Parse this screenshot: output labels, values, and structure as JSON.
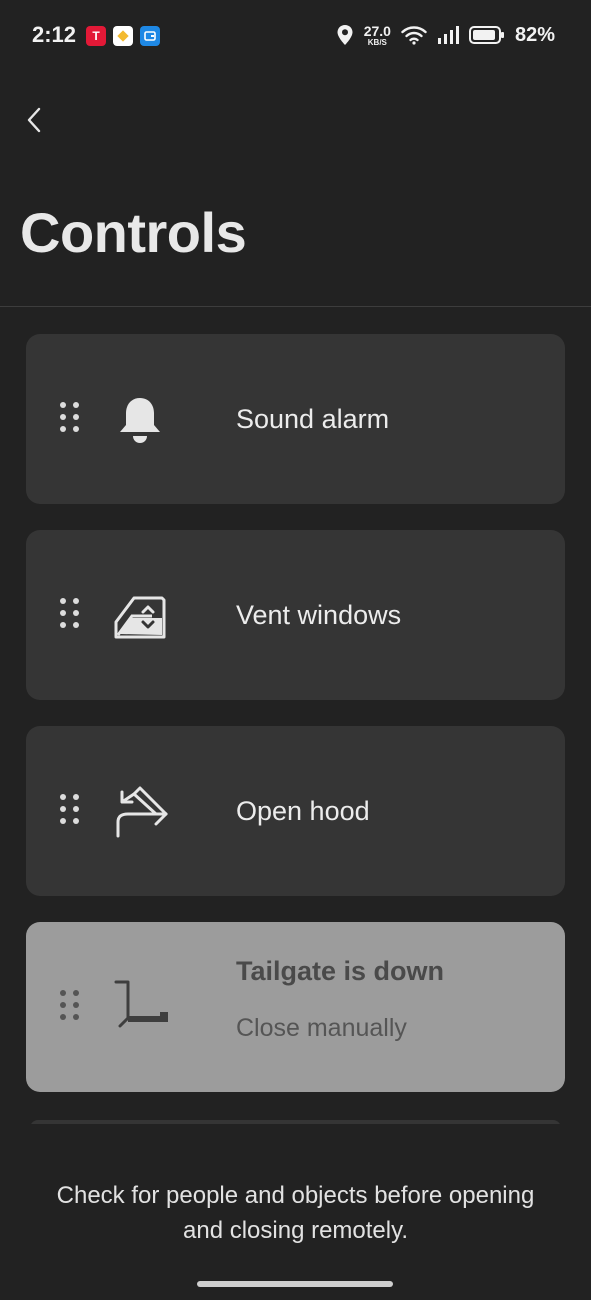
{
  "status_bar": {
    "time": "2:12",
    "net_speed_value": "27.0",
    "net_speed_unit": "KB/S",
    "battery_percent": "82%",
    "app_badges": [
      {
        "name": "tesla-app-icon",
        "color": "#e31937"
      },
      {
        "name": "binance-app-icon",
        "color": "#f3ba2f"
      },
      {
        "name": "wallet-app-icon",
        "color": "#1e88e5"
      }
    ]
  },
  "header": {
    "back_icon": "chevron-left-icon",
    "title": "Controls"
  },
  "controls": [
    {
      "label": "Sound alarm",
      "icon": "bell-icon"
    },
    {
      "label": "Vent windows",
      "icon": "vent-window-icon"
    },
    {
      "label": "Open hood",
      "icon": "hood-icon"
    },
    {
      "label": "Tailgate is down",
      "sublabel": "Close manually",
      "icon": "tailgate-icon",
      "disabled": true
    }
  ],
  "footer": {
    "note_line1": "Check for people and objects before opening",
    "note_line2": "and closing remotely."
  },
  "colors": {
    "background": "#222222",
    "card": "#353535",
    "card_disabled": "#9c9c9c",
    "text": "#ececec"
  }
}
